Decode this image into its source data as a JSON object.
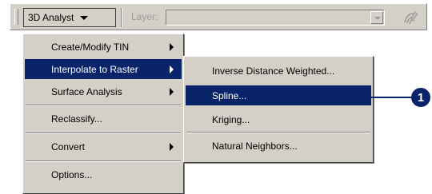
{
  "toolbar": {
    "analyst_label": "3D Analyst",
    "layer_label": "Layer:",
    "layer_value": ""
  },
  "menu": {
    "items": [
      {
        "label": "Create/Modify TIN",
        "submenu": true
      },
      {
        "label": "Interpolate to Raster",
        "submenu": true,
        "highlighted": true
      },
      {
        "label": "Surface Analysis",
        "submenu": true
      },
      {
        "label": "Reclassify...",
        "submenu": false
      },
      {
        "label": "Convert",
        "submenu": true
      },
      {
        "label": "Options...",
        "submenu": false
      }
    ]
  },
  "submenu": {
    "items": [
      {
        "label": "Inverse Distance Weighted..."
      },
      {
        "label": "Spline...",
        "highlighted": true
      },
      {
        "label": "Kriging..."
      },
      {
        "label": "Natural Neighbors..."
      }
    ]
  },
  "callout": {
    "number": "1"
  },
  "colors": {
    "highlight": "#0a246a",
    "menu_bg": "#d4d0c8"
  }
}
